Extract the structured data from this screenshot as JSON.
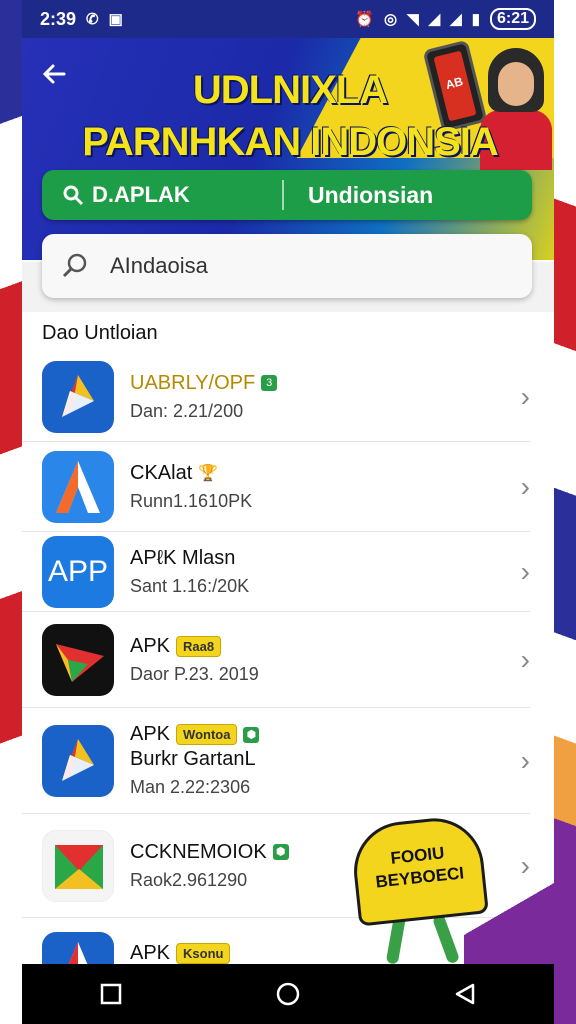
{
  "status_bar": {
    "time": "2:39",
    "battery": "6:21",
    "icons_left": [
      "whatsapp-icon",
      "message-icon"
    ],
    "icons_right": [
      "alarm-icon",
      "vpn-icon",
      "wifi-icon",
      "signal-icon",
      "signal-icon",
      "battery-icon"
    ]
  },
  "header": {
    "title_line1": "UDLNIXLA",
    "title_line2": "PARNHKAN INDONSIA",
    "phone_label": "AB",
    "filter_left": "D.APLAK",
    "filter_right": "Undionsian"
  },
  "search": {
    "value": "AIndaoisa"
  },
  "section": {
    "title": "Dao Untloian"
  },
  "apps": [
    {
      "name": "UABRLY/OPF",
      "sub": "Dan: 2.21/200",
      "badge": "",
      "tag": "3"
    },
    {
      "name": "CKAlat",
      "sub": "Runn1.1610PK",
      "badge": "",
      "tag": ""
    },
    {
      "name": "APℓK Mlasn",
      "sub": "Sant 1.16:/20K",
      "badge": "",
      "tag": "",
      "icon_text": "APP"
    },
    {
      "name": "APK",
      "sub": "Daor P.23. 2019",
      "badge": "Raa8",
      "tag": ""
    },
    {
      "name": "APK",
      "sub2": "Burkr GartanL",
      "sub": "Man 2.22:2306",
      "badge": "Wontoa",
      "tag": ""
    },
    {
      "name": "CCKNEMOIOK",
      "sub": "Raok2.961290",
      "badge": "",
      "tag": ""
    },
    {
      "name": "APK",
      "sub": "",
      "badge": "Ksonu",
      "tag": ""
    }
  ],
  "overlay_promo": {
    "line1": "FOOIU",
    "line2": "BEYBOECI"
  },
  "colors": {
    "status_bg": "#1e2a8a",
    "header_blue": "#2630b8",
    "accent_yellow": "#f2d51c",
    "green": "#1e9d48"
  }
}
